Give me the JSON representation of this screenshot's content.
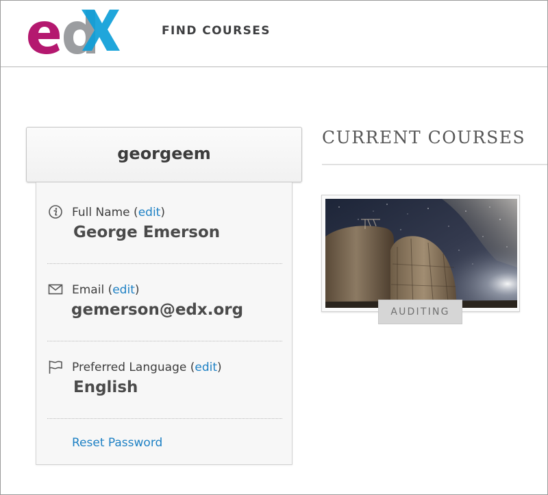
{
  "header": {
    "logo_alt": "edX",
    "nav": {
      "find_courses": "FIND COURSES"
    }
  },
  "profile": {
    "username": "georgeem",
    "full_name": {
      "label": "Full Name",
      "edit": "edit",
      "value": "George Emerson"
    },
    "email": {
      "label": "Email",
      "edit": "edit",
      "value": "gemerson@edx.org"
    },
    "language": {
      "label": "Preferred Language",
      "edit": "edit",
      "value": "English"
    },
    "reset_password": "Reset Password"
  },
  "courses": {
    "title": "CURRENT COURSES",
    "items": [
      {
        "status": "AUDITING"
      }
    ]
  },
  "colors": {
    "link": "#1d80c4",
    "logo_magenta": "#b4186f",
    "logo_gray": "#8a8c8f",
    "logo_blue": "#0d9ed8"
  },
  "icons": {
    "full_name": "info-circle-icon",
    "email": "envelope-icon",
    "language": "flag-icon"
  }
}
